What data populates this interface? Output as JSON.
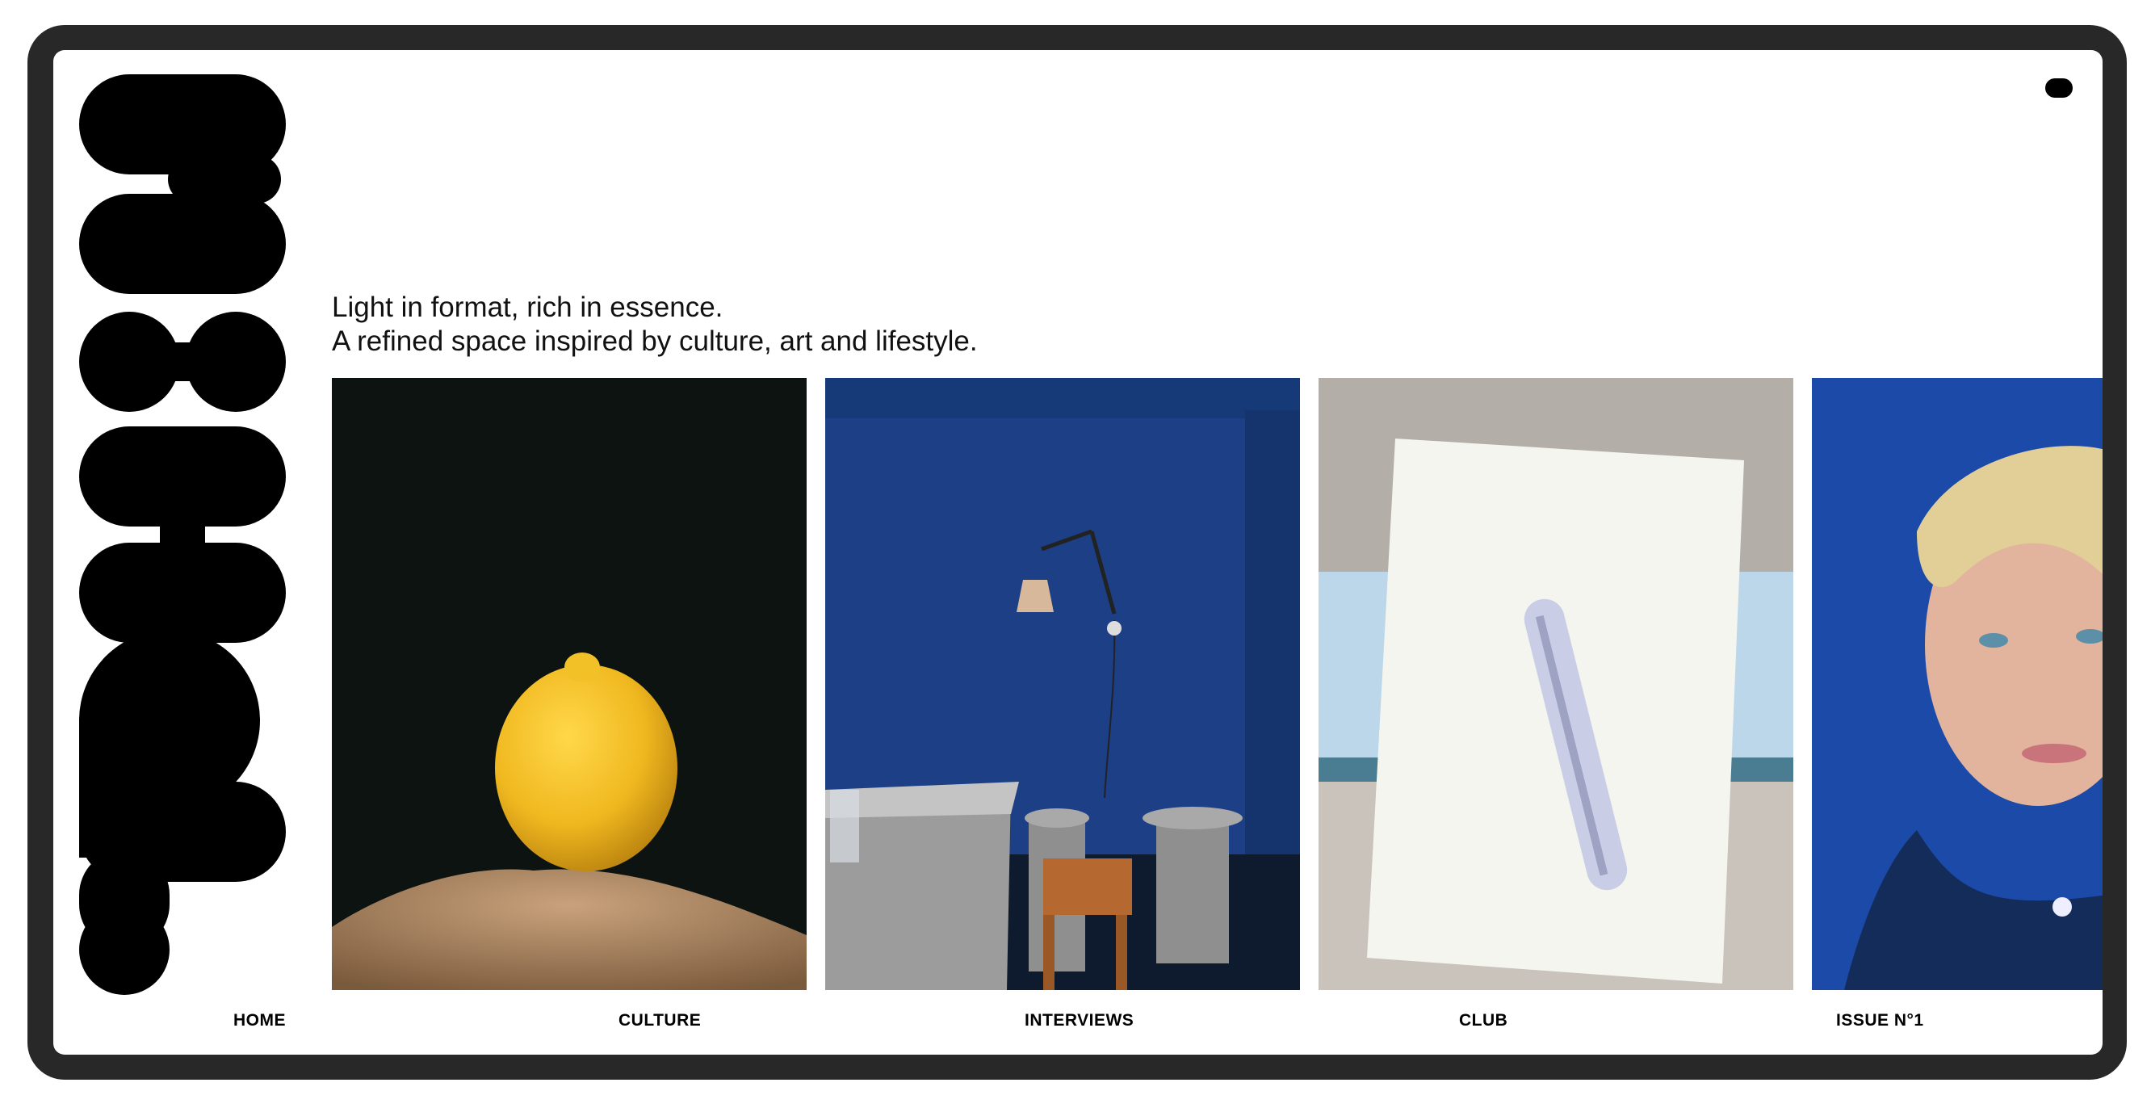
{
  "tagline": {
    "line1": "Light in format, rich in essence.",
    "line2": "A refined space inspired by culture, art and lifestyle."
  },
  "gallery": {
    "items": [
      {
        "name": "lemon-on-rock-image",
        "description_icon": "lemon-photo"
      },
      {
        "name": "blue-room-lamp-image",
        "description_icon": "interior-photo"
      },
      {
        "name": "white-sculpture-poster-image",
        "description_icon": "object-photo"
      },
      {
        "name": "blond-man-portrait-image",
        "description_icon": "portrait-photo"
      }
    ]
  },
  "nav": {
    "items": [
      {
        "label": "HOME"
      },
      {
        "label": "CULTURE"
      },
      {
        "label": "INTERVIEWS"
      },
      {
        "label": "CLUB"
      },
      {
        "label": "ISSUE N°1"
      }
    ]
  },
  "colors": {
    "frame": "#282828",
    "background": "#ffffff",
    "logo": "#000000",
    "blue_wall": "#1c3f86",
    "lemon": "#f2c027"
  }
}
